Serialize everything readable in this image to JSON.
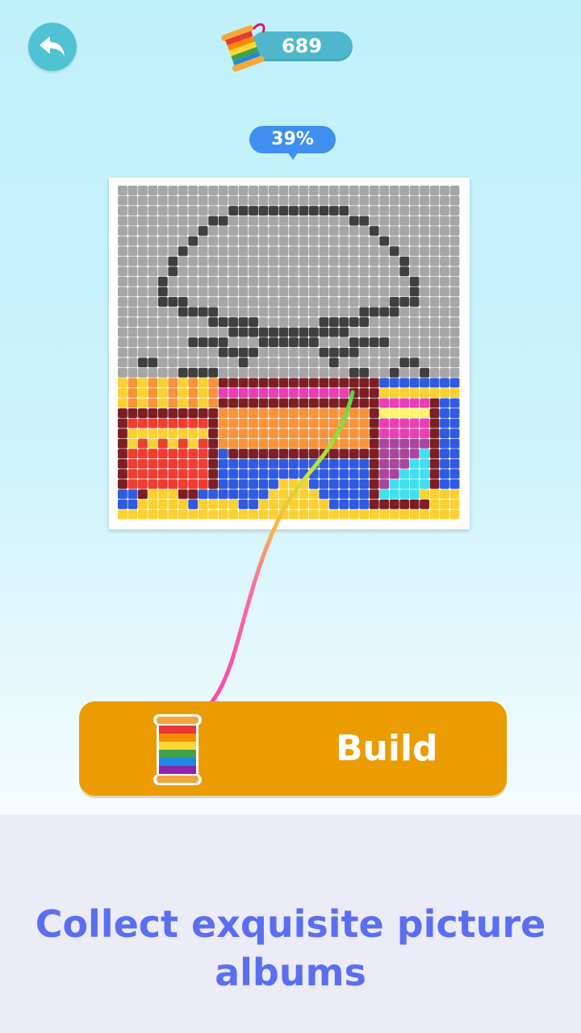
{
  "header": {
    "back_icon": "back-arrow-icon",
    "coin_icon": "thread-spool-icon",
    "coin_count": "689"
  },
  "puzzle": {
    "progress": "39%",
    "progress_value": 0.39
  },
  "build_button": {
    "label": "Build",
    "icon": "thread-spool-icon"
  },
  "footer": {
    "caption": "Collect exquisite picture albums"
  },
  "colors": {
    "background_top": "#bff1fb",
    "back_button": "#4fc2d3",
    "coin_pill": "#4fb7cd",
    "progress_bubble": "#3e8ff0",
    "build_button": "#ea9c02",
    "caption_text": "#5a6ff0",
    "footer_background": "#ecebf8"
  }
}
